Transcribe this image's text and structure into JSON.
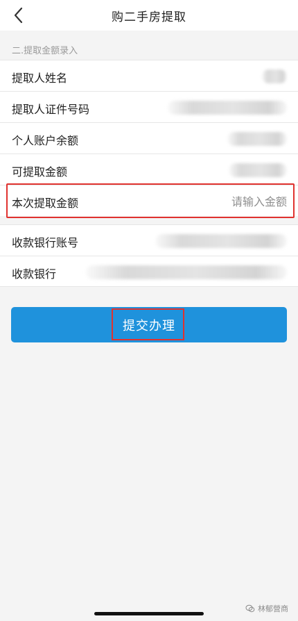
{
  "header": {
    "title": "购二手房提取",
    "back_icon": "chevron-left-icon"
  },
  "section": {
    "title": "二.提取金额录入"
  },
  "form": {
    "rows": [
      {
        "label": "提取人姓名"
      },
      {
        "label": "提取人证件号码"
      },
      {
        "label": "个人账户余额"
      },
      {
        "label": "可提取金额"
      },
      {
        "label": "本次提取金额",
        "placeholder": "请输入金额"
      },
      {
        "label": "收款银行账号"
      },
      {
        "label": "收款银行"
      }
    ]
  },
  "submit": {
    "label": "提交办理"
  },
  "watermark": {
    "text": "林郁營商"
  },
  "colors": {
    "primary": "#1f92dc",
    "highlight": "#e0322f",
    "background": "#f4f4f4"
  }
}
